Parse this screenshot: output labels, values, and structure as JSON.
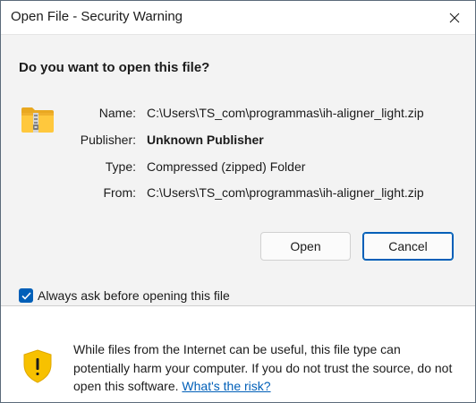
{
  "window": {
    "title": "Open File - Security Warning"
  },
  "dialog": {
    "question": "Do you want to open this file?",
    "file_icon": "zipped-folder-icon",
    "fields": [
      {
        "label": "Name:",
        "value": "C:\\Users\\TS_com\\programmas\\ih-aligner_light.zip"
      },
      {
        "label": "Publisher:",
        "value": "Unknown Publisher"
      },
      {
        "label": "Type:",
        "value": "Compressed (zipped) Folder"
      },
      {
        "label": "From:",
        "value": "C:\\Users\\TS_com\\programmas\\ih-aligner_light.zip"
      }
    ],
    "open_label": "Open",
    "cancel_label": "Cancel",
    "checkbox_label": "Always ask before opening this file",
    "checkbox_checked": true
  },
  "footer": {
    "icon": "warning-shield-icon",
    "warning_text": "While files from the Internet can be useful, this file type can potentially harm your computer. If you do not trust the source, do not open this software.",
    "risk_link": "What's the risk?"
  },
  "colors": {
    "accent": "#005fb8",
    "content_bg": "#f3f3f3",
    "shield": "#f7c100"
  }
}
